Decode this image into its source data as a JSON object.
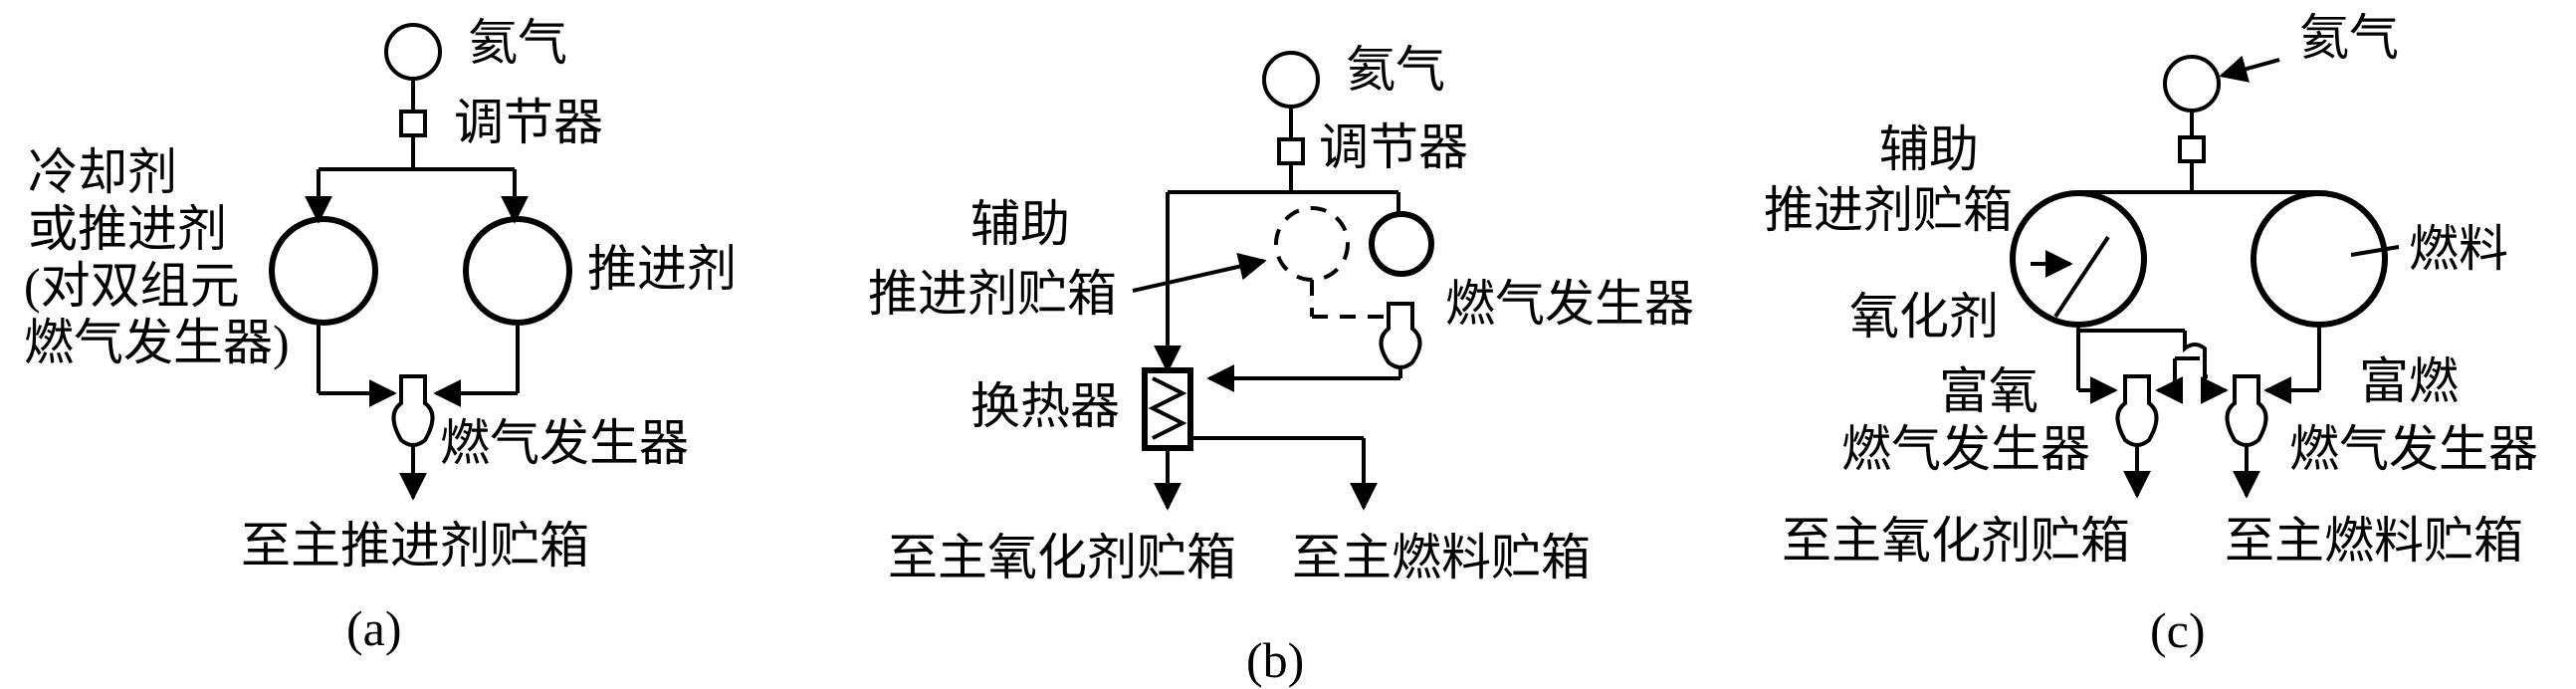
{
  "panel_a": {
    "helium": "氦气",
    "regulator": "调节器",
    "coolant_line1": "冷却剂",
    "coolant_line2": "或推进剂",
    "coolant_line3": "(对双组元",
    "coolant_line4": "燃气发生器)",
    "propellant": "推进剂",
    "gas_generator": "燃气发生器",
    "to_main_tank": "至主推进剂贮箱",
    "caption": "(a)"
  },
  "panel_b": {
    "helium": "氦气",
    "regulator": "调节器",
    "aux_tank_line1": "辅助",
    "aux_tank_line2": "推进剂贮箱",
    "gas_generator": "燃气发生器",
    "heat_exchanger": "换热器",
    "to_oxidizer_tank": "至主氧化剂贮箱",
    "to_fuel_tank": "至主燃料贮箱",
    "caption": "(b)"
  },
  "panel_c": {
    "helium": "氦气",
    "aux_tank_line1": "辅助",
    "aux_tank_line2": "推进剂贮箱",
    "oxidizer": "氧化剂",
    "fuel": "燃料",
    "ox_rich_line1": "富氧",
    "ox_rich_line2": "燃气发生器",
    "fuel_rich_line1": "富燃",
    "fuel_rich_line2": "燃气发生器",
    "to_oxidizer_tank": "至主氧化剂贮箱",
    "to_fuel_tank": "至主燃料贮箱",
    "caption": "(c)"
  }
}
